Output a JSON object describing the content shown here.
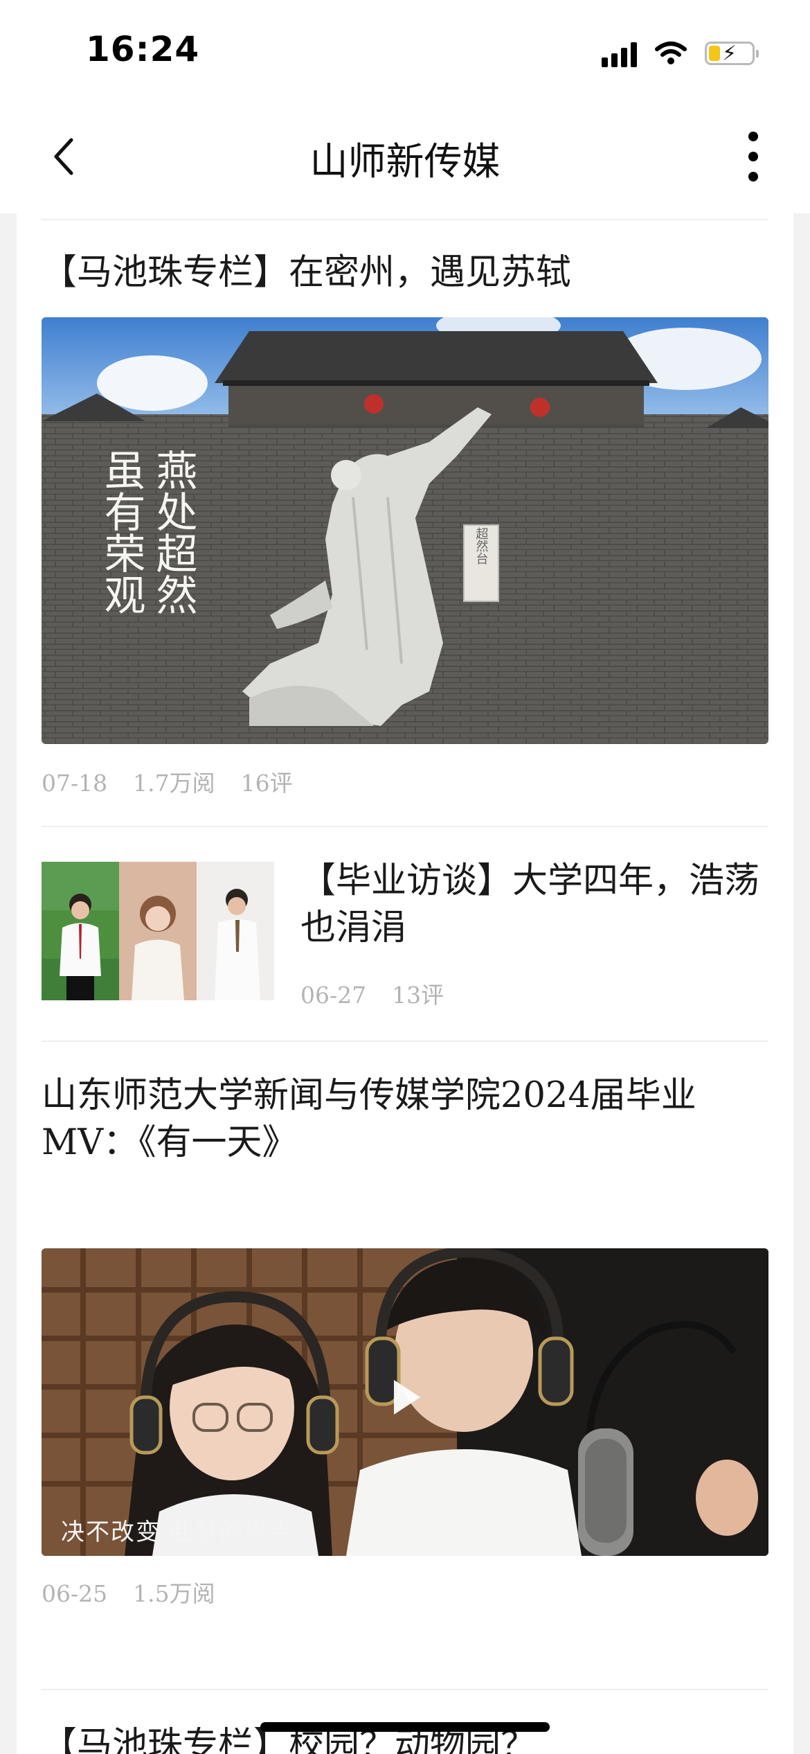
{
  "status_bar": {
    "time": "16:24"
  },
  "navbar": {
    "title": "山师新传媒"
  },
  "articles": [
    {
      "title": "【马池珠专栏】在密州，遇见苏轼",
      "date": "07-18",
      "reads": "1.7万阅",
      "comments": "16评",
      "image_text": [
        "燕处超然",
        "虽有荣观",
        "超然台"
      ]
    },
    {
      "title": "【毕业访谈】大学四年，浩荡也涓涓",
      "date": "06-27",
      "comments": "13评"
    },
    {
      "title": "山东师范大学新闻与传媒学院2024届毕业MV：《有一天》",
      "date": "06-25",
      "reads": "1.5万阅",
      "subtitle": "决不改变 赴梦的光点"
    },
    {
      "title": "【马池珠专栏】校园？动物园？"
    }
  ],
  "colors": {
    "meta_gray": "#b3b3b3",
    "background": "#f2f2f2",
    "card": "#ffffff"
  }
}
